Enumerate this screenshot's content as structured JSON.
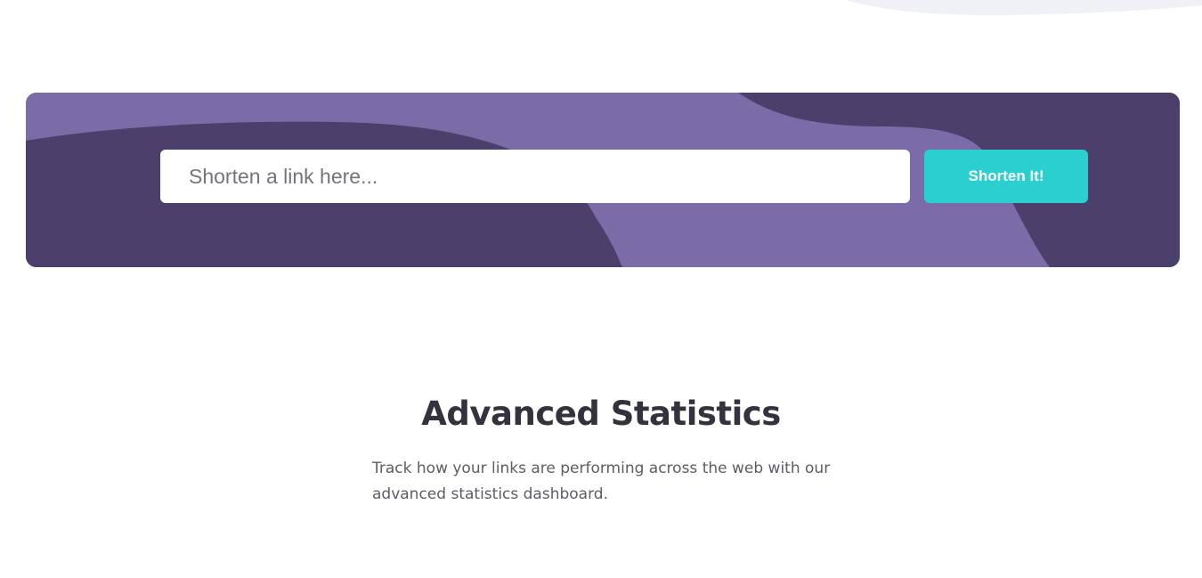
{
  "shorten": {
    "input_placeholder": "Shorten a link here...",
    "input_value": "",
    "button_label": "Shorten It!"
  },
  "statistics": {
    "title": "Advanced Statistics",
    "description": "Track how your links are performing across the web with our advanced statistics dashboard."
  },
  "colors": {
    "panel_dark": "#4b3f6b",
    "panel_light": "#7b6ba7",
    "accent_cyan": "#2acfcf",
    "heading_text": "#35323e",
    "body_text": "#5e5b67",
    "top_blob": "#f0f1f6"
  }
}
